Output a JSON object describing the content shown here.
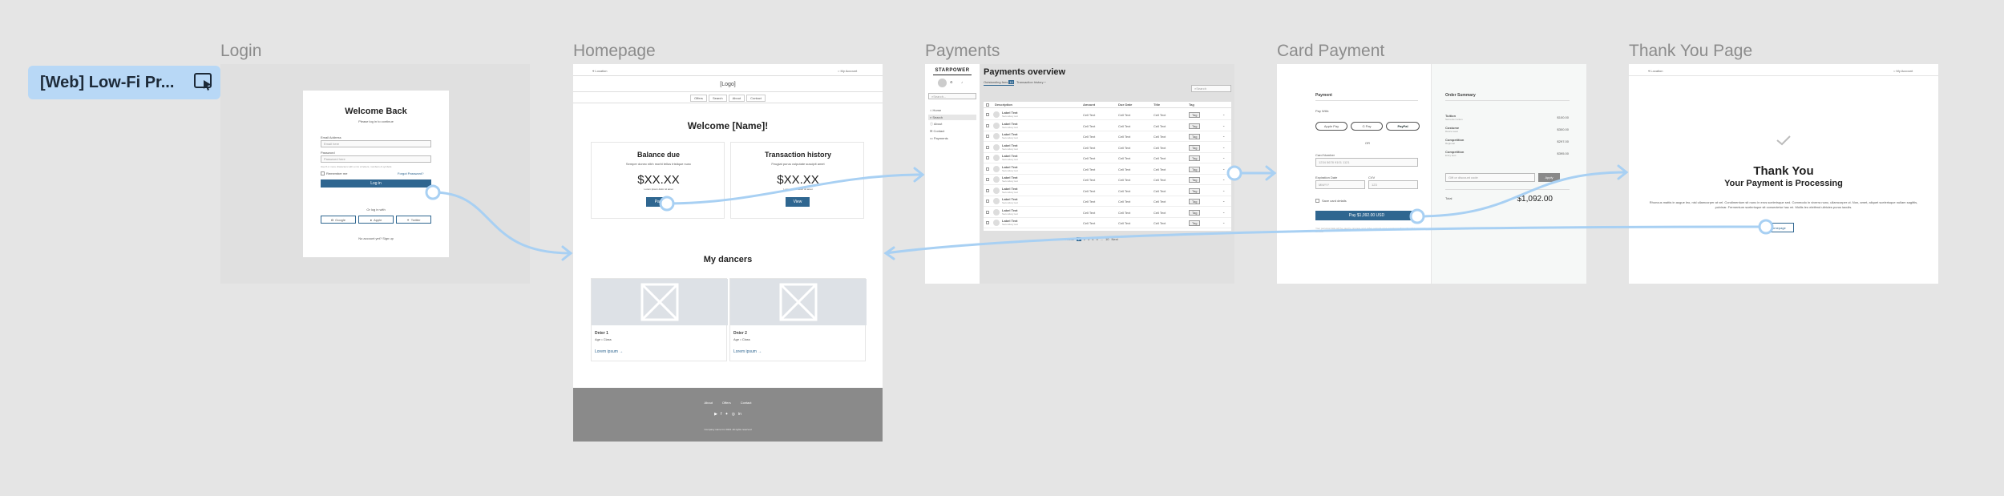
{
  "prototype_badge": {
    "title": "[Web] Low-Fi Pr...",
    "icon": "play-prototype-icon"
  },
  "frames": {
    "login": {
      "label": "Login"
    },
    "homepage": {
      "label": "Homepage"
    },
    "payments": {
      "label": "Payments"
    },
    "card_payment": {
      "label": "Card Payment"
    },
    "thank_you": {
      "label": "Thank You Page"
    }
  },
  "login": {
    "title": "Welcome Back",
    "subtitle": "Please log in to continue",
    "email_label": "Email Address",
    "email_placeholder": "Email here",
    "password_label": "Password",
    "password_placeholder": "Password here",
    "hint": "Use 8 or more characters with a mix of letters, numbers & symbols",
    "remember": "Remember me",
    "forgot": "Forgot Password?",
    "login_btn": "Log in",
    "or": "Or log in with",
    "google": "Google",
    "apple": "Apple",
    "twitter": "Twitter",
    "signup": "No account yet? Sign up"
  },
  "homepage": {
    "location": "Location",
    "account": "My Account",
    "logo": "[Logo]",
    "nav": [
      "Offers",
      "Search",
      "About",
      "Contact"
    ],
    "welcome": "Welcome [Name]!",
    "balance": {
      "title": "Balance due",
      "desc": "Semper donec nibh morbi tellus tristique nunc",
      "amount": "$XX.XX",
      "note": "Lorem ipsum dolor sit amet",
      "btn": "Pay"
    },
    "history": {
      "title": "Transaction history",
      "desc": "Feugiat purus vulputate suscipit amet",
      "amount": "$XX.XX",
      "note": "Lorem ipsum dolor sit amet",
      "btn": "View"
    },
    "dancers_title": "My dancers",
    "dancers": [
      {
        "name": "Dnier 1",
        "meta": "Age • Class",
        "link": "Lorem ipsum"
      },
      {
        "name": "Dnier 2",
        "meta": "Age • Class",
        "link": "Lorem ipsum"
      }
    ],
    "footer_links": [
      "About",
      "Offers",
      "Contact"
    ],
    "copyright": "Company name Inc 2024. All rights reserved"
  },
  "payments": {
    "brand": "STARPOWER",
    "search_placeholder": "Search...",
    "menu": [
      "Home",
      "Search",
      "About",
      "Contact",
      "Payments"
    ],
    "title": "Payments overview",
    "tabs": [
      "Outstanding fees",
      "Transaction history"
    ],
    "tab_count": "10",
    "table_search": "Search",
    "columns": [
      "Description",
      "Amount",
      "Due Date",
      "Title",
      "Tag"
    ],
    "rows": [
      {
        "name": "Label Text",
        "sub": "Secondary text",
        "amount": "Cell Text",
        "due": "Cell Text",
        "title": "Cell Text",
        "tag": "Tag"
      },
      {
        "name": "Label Text",
        "sub": "Secondary text",
        "amount": "Cell Text",
        "due": "Cell Text",
        "title": "Cell Text",
        "tag": "Tag"
      },
      {
        "name": "Label Text",
        "sub": "Secondary text",
        "amount": "Cell Text",
        "due": "Cell Text",
        "title": "Cell Text",
        "tag": "Tag"
      },
      {
        "name": "Label Text",
        "sub": "Secondary text",
        "amount": "Cell Text",
        "due": "Cell Text",
        "title": "Cell Text",
        "tag": "Tag"
      },
      {
        "name": "Label Text",
        "sub": "Secondary text",
        "amount": "Cell Text",
        "due": "Cell Text",
        "title": "Cell Text",
        "tag": "Tag"
      },
      {
        "name": "Label Text",
        "sub": "Secondary text",
        "amount": "Cell Text",
        "due": "Cell Text",
        "title": "Cell Text",
        "tag": "Tag"
      },
      {
        "name": "Label Text",
        "sub": "Secondary text",
        "amount": "Cell Text",
        "due": "Cell Text",
        "title": "Cell Text",
        "tag": "Tag"
      },
      {
        "name": "Label Text",
        "sub": "Secondary text",
        "amount": "Cell Text",
        "due": "Cell Text",
        "title": "Cell Text",
        "tag": "Tag"
      },
      {
        "name": "Label Text",
        "sub": "Secondary text",
        "amount": "Cell Text",
        "due": "Cell Text",
        "title": "Cell Text",
        "tag": "Tag"
      },
      {
        "name": "Label Text",
        "sub": "Secondary text",
        "amount": "Cell Text",
        "due": "Cell Text",
        "title": "Cell Text",
        "tag": "Tag"
      },
      {
        "name": "Label Text",
        "sub": "Secondary text",
        "amount": "Cell Text",
        "due": "Cell Text",
        "title": "Cell Text",
        "tag": "Tag"
      }
    ],
    "pagination": {
      "prev": "Previous",
      "pages": [
        "1",
        "2",
        "3",
        "4",
        "5",
        "...",
        "10"
      ],
      "next": "Next"
    }
  },
  "card": {
    "payment_title": "Payment",
    "pay_with": "Pay With:",
    "wallets": [
      "Apple Pay",
      "G Pay",
      "PayPal"
    ],
    "or": "OR",
    "card_number_label": "Card Number",
    "card_number_ph": "1234 5678 9101 1121",
    "expiry_label": "Expiration Date",
    "expiry_ph": "MM/YY",
    "cvv_label": "CVV",
    "cvv_ph": "123",
    "save_card": "Save card details",
    "pay_btn": "Pay $1,092.00 USD",
    "disclaimer": "Your personal data will be used to process your order, support your experience throughout this website",
    "summary_title": "Order Summary",
    "items": [
      {
        "name": "Tuition",
        "sub": "Semester tuition",
        "price": "$100.00"
      },
      {
        "name": "Costume",
        "sub": "Dance wear",
        "price": "$300.00"
      },
      {
        "name": "Competition",
        "sub": "Regional",
        "price": "$297.00"
      },
      {
        "name": "Competition",
        "sub": "Entry fees",
        "price": "$395.00"
      }
    ],
    "discount_ph": "Gift or discount code",
    "apply": "Apply",
    "total_label": "Total",
    "total": "$1,092.00"
  },
  "thanks": {
    "location": "Location",
    "account": "My Account",
    "title": "Thank You",
    "subtitle": "Your Payment is Processing",
    "body": "Rhoncus mattis in augue leo, nisl ullamcorper at vel. Condimentum sit nunc in eros scelerisque sed. Commodo in viverra nunc, ullamcorper ut. Non, amet, aliquet scelerisque nullam sagittis, pulvinar. Fermentum scelerisque sit consectetur hac mi. Mollis leo eleifend ultricies purus iaculis.",
    "btn": "Homepage"
  },
  "colors": {
    "accent": "#2f6690",
    "flow": "#a8d0f3",
    "canvas": "#e5e5e5",
    "badge": "#b8d8f6"
  }
}
